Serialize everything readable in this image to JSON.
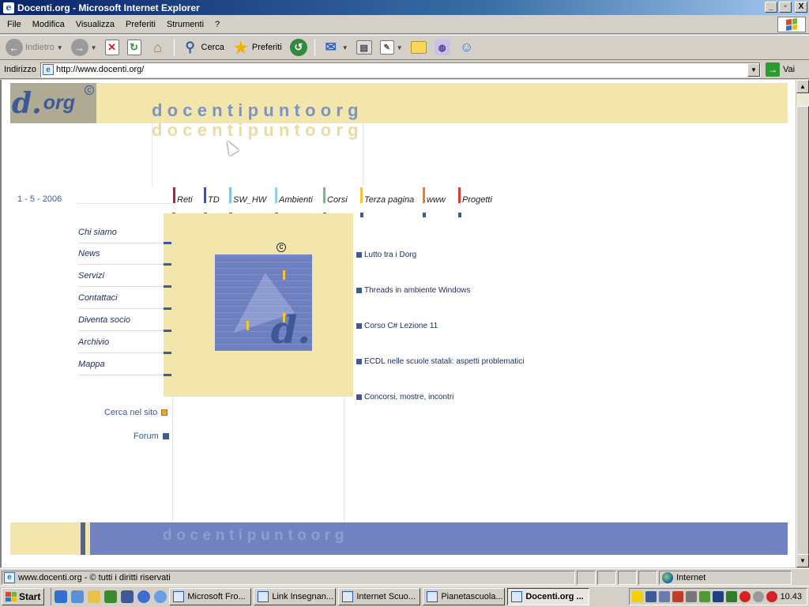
{
  "window": {
    "title": "Docenti.org - Microsoft Internet Explorer",
    "minimize": "_",
    "maximize": "▫",
    "close": "X"
  },
  "menu": [
    "File",
    "Modifica",
    "Visualizza",
    "Preferiti",
    "Strumenti",
    "?"
  ],
  "toolbar": {
    "back_label": "Indietro",
    "search_label": "Cerca",
    "favorites_label": "Preferiti"
  },
  "address": {
    "label": "Indirizzo",
    "url": "http://www.docenti.org/",
    "go_label": "Vai"
  },
  "page": {
    "logo_text": "org",
    "logo_letter": "d.",
    "brand": "docentipuntoorg",
    "date": "1 - 5 - 2006",
    "tabs": [
      {
        "label": "Reti",
        "color": "#b3243a"
      },
      {
        "label": "TD",
        "color": "#3d5a96"
      },
      {
        "label": "SW_HW",
        "color": "#7ec6e4"
      },
      {
        "label": "Ambienti",
        "color": "#8fd3e0"
      },
      {
        "label": "Corsi",
        "color": "#6fbf7a"
      },
      {
        "label": "Terza pagina",
        "color": "#f2c534"
      },
      {
        "label": "www",
        "color": "#e8802a"
      },
      {
        "label": "Progetti",
        "color": "#d9402a"
      }
    ],
    "left_links": [
      "Chi siamo",
      "News",
      "Servizi",
      "Contattaci",
      "Diventa socio",
      "Archivio",
      "Mappa"
    ],
    "news": [
      "Lutto tra i Dorg",
      "Threads in ambiente Windows",
      "Corso C# Lezione 11",
      "ECDL nelle scuole statali: aspetti problematici",
      "Concorsi, mostre, incontri"
    ],
    "search_site": "Cerca nel sito",
    "search_site_color": "#e8a23a",
    "forum": "Forum",
    "forum_color": "#3d5a96",
    "footer_brand": "docentipuntoorg",
    "accent_color": "#f2e6ad",
    "blue_color": "#7083c0"
  },
  "status": {
    "text": "www.docenti.org - © tutti i diritti riservati",
    "zone": "Internet"
  },
  "taskbar": {
    "start": "Start",
    "tasks": [
      "Microsoft Fro...",
      "Link Insegnan...",
      "Internet Scuo...",
      "Pianetascuola...",
      "Docenti.org ..."
    ],
    "clock": "10.43"
  }
}
